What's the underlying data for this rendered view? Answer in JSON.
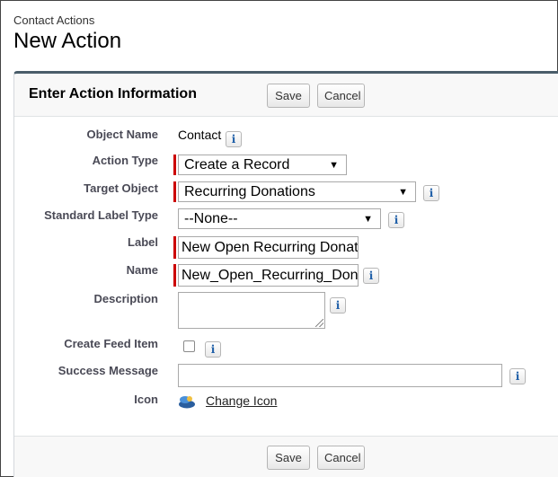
{
  "header": {
    "breadcrumb": "Contact Actions",
    "title": "New Action"
  },
  "panel": {
    "title": "Enter Action Information",
    "save_label": "Save",
    "cancel_label": "Cancel"
  },
  "form": {
    "object_name": {
      "label": "Object Name",
      "value": "Contact"
    },
    "action_type": {
      "label": "Action Type",
      "value": "Create a Record"
    },
    "target_object": {
      "label": "Target Object",
      "value": "Recurring Donations"
    },
    "standard_label_type": {
      "label": "Standard Label Type",
      "value": "--None--"
    },
    "label": {
      "label": "Label",
      "value": "New Open Recurring Donation"
    },
    "name": {
      "label": "Name",
      "value": "New_Open_Recurring_Donation"
    },
    "description": {
      "label": "Description",
      "value": ""
    },
    "create_feed_item": {
      "label": "Create Feed Item",
      "checked": false
    },
    "success_message": {
      "label": "Success Message",
      "value": ""
    },
    "icon": {
      "label": "Icon",
      "link": "Change Icon"
    }
  },
  "icons": {
    "info": "i",
    "dropdown": "▼"
  },
  "colors": {
    "required": "#cc0000",
    "panel_border": "#4a5d6a",
    "info_glyph": "#1f5fa8"
  }
}
